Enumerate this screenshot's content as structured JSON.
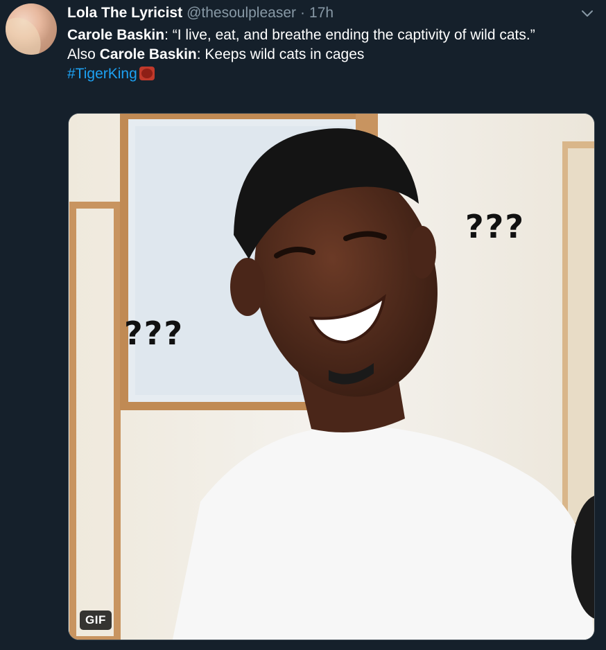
{
  "author": {
    "display_name": "Lola The Lyricist",
    "handle": "@thesoulpleaser",
    "separator": "·",
    "timestamp": "17h"
  },
  "tweet": {
    "line1_bold": "Carole Baskin",
    "line1_rest": ": “I live, eat, and breathe ending the captivity of wild cats.”",
    "line2_prefix": "Also ",
    "line2_bold": "Carole Baskin",
    "line2_rest": ": Keeps wild cats in cages",
    "hashtag": "#TigerKing"
  },
  "media": {
    "caption_left": "???",
    "caption_right": "???",
    "badge": "GIF"
  },
  "icons": {
    "menu": "chevron-down-icon",
    "emoji": "tiger-emoji-icon"
  },
  "colors": {
    "background": "#15202b",
    "secondary_text": "#8899a6",
    "link": "#1da1f2",
    "border": "#38444d"
  }
}
